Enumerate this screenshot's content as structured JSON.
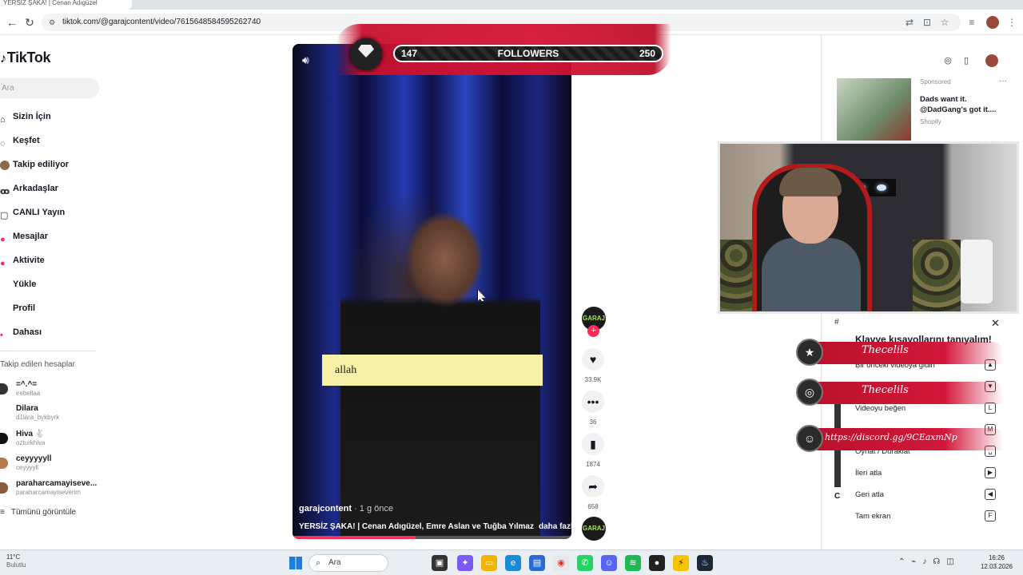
{
  "browser": {
    "tab_title": "YERSİZ ŞAKA! | Cenan Adıgüzel",
    "url": "tiktok.com/@garajcontent/video/7615648584595262740"
  },
  "sidebar": {
    "logo": "TikTok",
    "search_placeholder": "Ara",
    "nav": [
      {
        "label": "Sizin İçin",
        "icon": "home-icon"
      },
      {
        "label": "Keşfet",
        "icon": "compass-icon"
      },
      {
        "label": "Takip ediliyor",
        "icon": "following-icon"
      },
      {
        "label": "Arkadaşlar",
        "icon": "friends-icon"
      },
      {
        "label": "CANLI Yayın",
        "icon": "live-icon"
      },
      {
        "label": "Mesajlar",
        "icon": "messages-icon"
      },
      {
        "label": "Aktivite",
        "icon": "activity-icon"
      },
      {
        "label": "Yükle",
        "icon": "upload-icon"
      },
      {
        "label": "Profil",
        "icon": "profile-icon"
      },
      {
        "label": "Dahası",
        "icon": "more-icon"
      }
    ],
    "following_header": "Takip edilen hesaplar",
    "following": [
      {
        "name": "=^.^=",
        "handle": "irebellaa"
      },
      {
        "name": "Dilara",
        "handle": "d1lara_bykbyrk"
      },
      {
        "name": "Hiva 🐇",
        "handle": "ozturkhiva"
      },
      {
        "name": "ceyyyyyll",
        "handle": "ceyyyyll"
      },
      {
        "name": "paraharcamayiseve...",
        "handle": "paraharcamayiseverim"
      }
    ],
    "see_all": "Tümünü görüntüle"
  },
  "overlay_goal": {
    "current": "147",
    "label": "FOLLOWERS",
    "target": "250"
  },
  "video": {
    "caption_box": "allah",
    "author": "garajcontent",
    "posted": "· 1 g önce",
    "description": "YERSİZ ŞAKA! | Cenan Adıgüzel, Emre Aslan ve Tuğba Yılmaz",
    "more": "daha fazlası",
    "progress": 0.44
  },
  "actions": {
    "avatar_label": "GARAJ",
    "likes": "33.9K",
    "comments": "36",
    "saves": "1874",
    "shares": "658",
    "music_label": "GARAJ"
  },
  "ad": {
    "sponsored": "Sponsored",
    "text": "Dads want it. @DadGang's got it....",
    "brand": "Shopify"
  },
  "shortcuts": {
    "hash": "#",
    "title": "Klavye kısayollarını tanıyalım!",
    "rows": [
      {
        "label": "Bir önceki videoya gidin",
        "key": "▲"
      },
      {
        "label": "",
        "key": "▼"
      },
      {
        "label": "Videoyu beğen",
        "key": "L"
      },
      {
        "label": "",
        "key": "M"
      },
      {
        "label": "Oynat / Duraklat",
        "key": "␣"
      },
      {
        "label": "İleri atla",
        "key": "▶"
      },
      {
        "label": "Geri atla",
        "key": "◀"
      },
      {
        "label": "Tam ekran",
        "key": "F"
      }
    ],
    "c_label": "C"
  },
  "socials": [
    {
      "icon": "★",
      "text": "Thecelils"
    },
    {
      "icon": "◎",
      "text": "Thecelils"
    },
    {
      "icon": "☺",
      "text": "https://discord.gg/9CEaxmNp"
    }
  ],
  "taskbar": {
    "temp": "11°C",
    "weather": "Bulutlu",
    "search": "Ara",
    "time": "16:26",
    "date": "12.03.2026"
  },
  "colors": {
    "accent": "#fe2c55",
    "overlay_red": "#d41433"
  }
}
